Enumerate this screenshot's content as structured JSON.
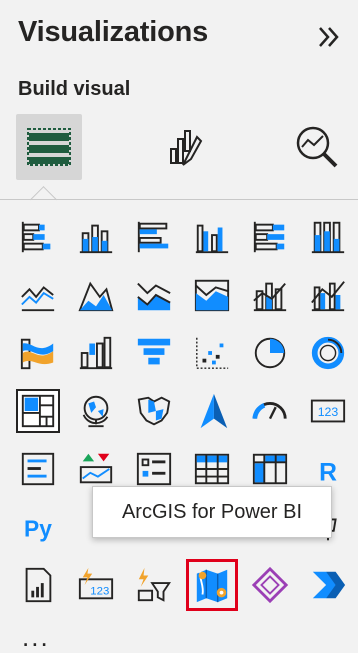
{
  "pane": {
    "title": "Visualizations",
    "subtitle": "Build visual",
    "collapse_icon": "chevron-double-right-icon",
    "more_label": "..."
  },
  "modes": [
    {
      "name": "build-visual-tab",
      "icon": "build-visual-icon",
      "selected": true
    },
    {
      "name": "format-visual-tab",
      "icon": "format-paintbrush-icon",
      "selected": false
    },
    {
      "name": "analytics-tab",
      "icon": "analytics-magnifier-icon",
      "selected": false
    }
  ],
  "visuals": [
    [
      "stacked-bar-chart",
      "stacked-column-chart",
      "clustered-bar-chart",
      "clustered-column-chart",
      "100-stacked-bar-chart",
      "100-stacked-column-chart"
    ],
    [
      "line-chart",
      "area-chart",
      "stacked-area-chart",
      "100-stacked-area-chart",
      "line-and-stacked-column-chart",
      "line-and-clustered-column-chart"
    ],
    [
      "ribbon-chart",
      "waterfall-chart",
      "funnel-chart",
      "scatter-chart",
      "pie-chart",
      "donut-chart"
    ],
    [
      "treemap",
      "map",
      "filled-map",
      "azure-map",
      "gauge",
      "card"
    ],
    [
      "multi-row-card",
      "kpi",
      "slicer",
      "table",
      "matrix",
      "r-script-visual"
    ],
    [
      "python-visual",
      "",
      "",
      "",
      "",
      ""
    ],
    [
      "paginated-report",
      "power-apps",
      "power-apps-filter",
      "arcgis-for-power-bi",
      "power-automate",
      "power-automate-flow"
    ]
  ],
  "python_label": "Py",
  "r_label": "R",
  "card_label": "123",
  "tooltip": "ArcGIS for Power BI",
  "colors": {
    "accent": "#118dff",
    "green": "#1f5c3f",
    "teal": "#0b6a5a",
    "highlight": "#e0001b",
    "purple": "#9b3fb5",
    "orange": "#f1a32c"
  }
}
